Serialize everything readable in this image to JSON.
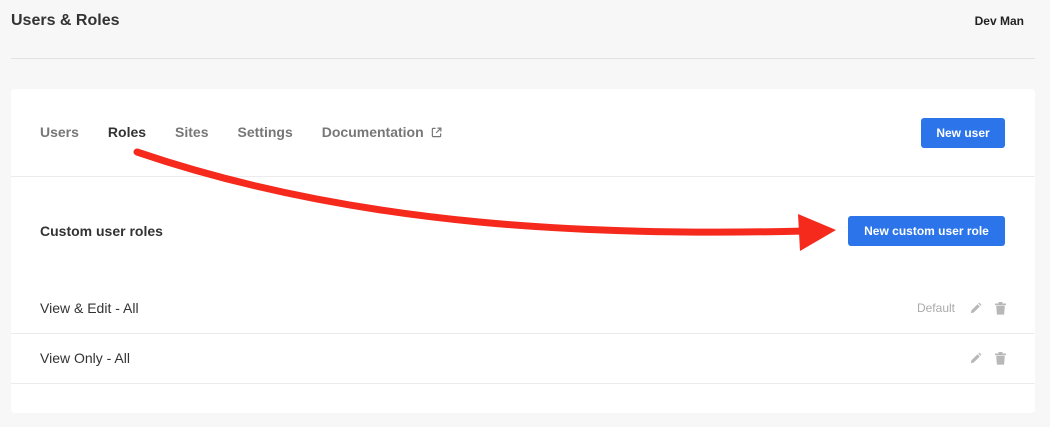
{
  "header": {
    "title": "Users & Roles",
    "user": "Dev Man"
  },
  "tabs": [
    {
      "label": "Users",
      "active": false
    },
    {
      "label": "Roles",
      "active": true
    },
    {
      "label": "Sites",
      "active": false
    },
    {
      "label": "Settings",
      "active": false
    },
    {
      "label": "Documentation",
      "active": false,
      "icon": "external-link-icon"
    }
  ],
  "actions": {
    "new_user": "New user",
    "new_custom_role": "New custom user role"
  },
  "section": {
    "title": "Custom user roles"
  },
  "roles": [
    {
      "name": "View & Edit - All",
      "badge": "Default"
    },
    {
      "name": "View Only - All",
      "badge": ""
    }
  ],
  "colors": {
    "accent": "#2b74e9",
    "annotation_arrow": "#f5291c"
  },
  "icons": {
    "edit": "pencil-icon",
    "delete": "trash-icon"
  }
}
